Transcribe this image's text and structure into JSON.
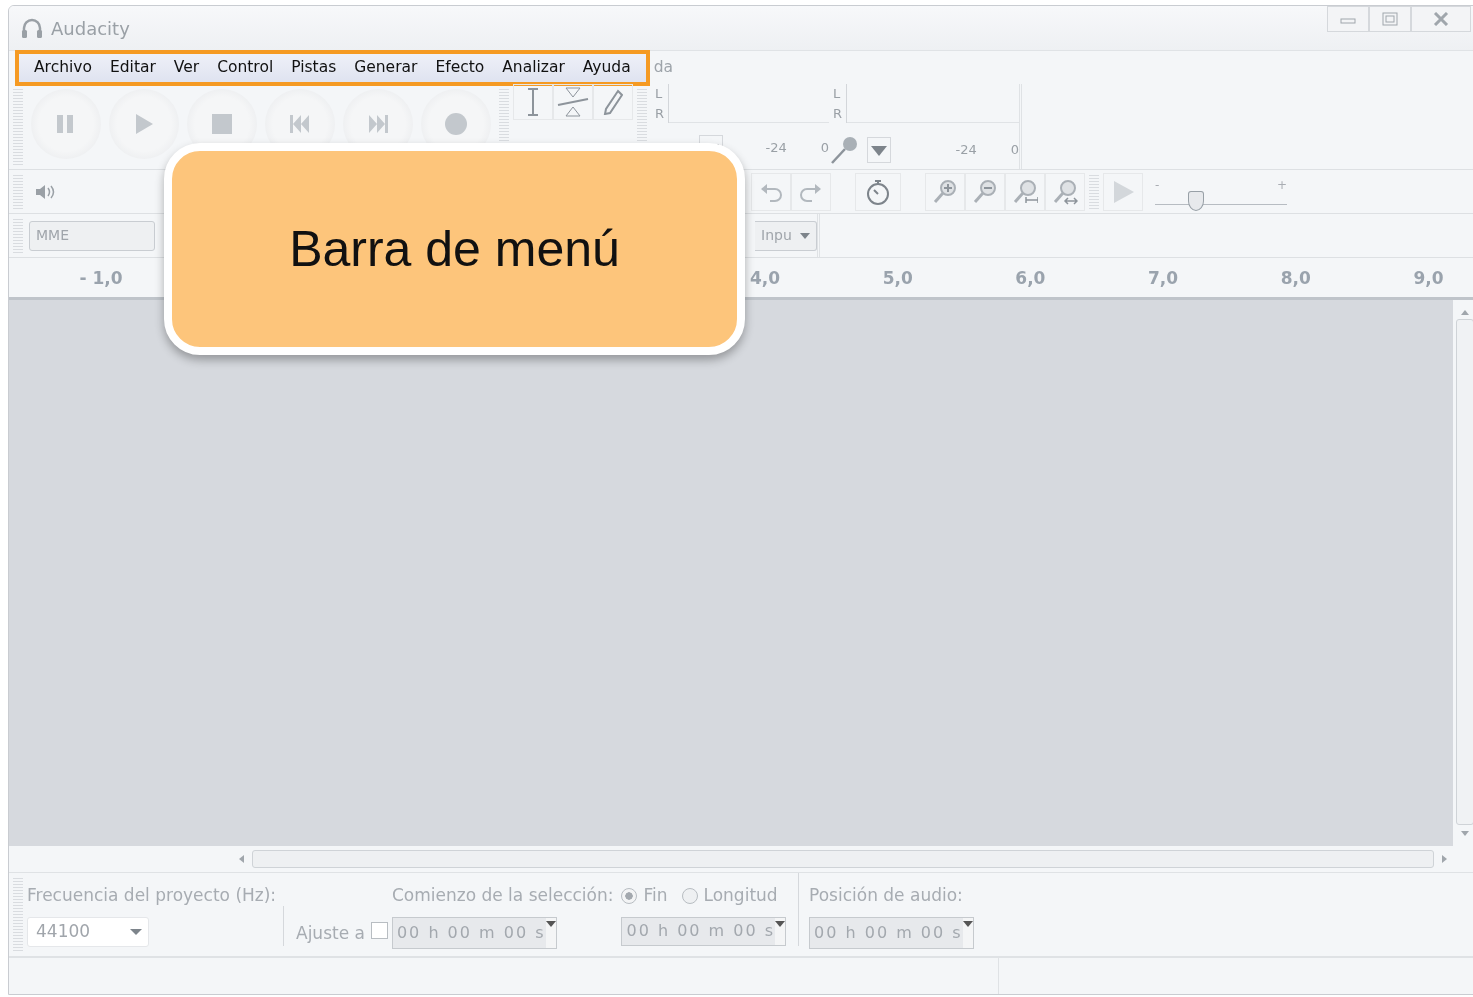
{
  "window": {
    "title": "Audacity"
  },
  "menu_bar": {
    "highlighted": true,
    "items": [
      "Archivo",
      "Editar",
      "Ver",
      "Control",
      "Pistas",
      "Generar",
      "Efecto",
      "Analizar",
      "Ayuda"
    ],
    "overflow_text": "da"
  },
  "meters": [
    {
      "channels": [
        "L",
        "R"
      ],
      "scale": [
        "-24",
        "0"
      ]
    },
    {
      "channels": [
        "L",
        "R"
      ],
      "scale": [
        "-24",
        "0"
      ]
    }
  ],
  "speed_slider": {
    "min_label": "-",
    "max_label": "+",
    "level": 0.31
  },
  "device_bar": {
    "host": "MME",
    "input": "Inpu"
  },
  "ruler": [
    "- 1,0",
    "4,0",
    "5,0",
    "6,0",
    "7,0",
    "8,0",
    "9,0"
  ],
  "callout": {
    "text": "Barra de menú"
  },
  "selection_bar": {
    "rate_label": "Frecuencia del proyecto (Hz):",
    "rate": "44100",
    "snap_label": "Ajuste a",
    "snap_checked": false,
    "start_label": "Comienzo de la selección:",
    "start": "00 h 00 m 00 s",
    "modes": [
      {
        "label": "Fin",
        "selected": true
      },
      {
        "label": "Longitud",
        "selected": false
      }
    ],
    "end": "00 h 00 m 00 s",
    "position_label": "Posición de audio:",
    "position": "00 h 00 m 00 s"
  }
}
